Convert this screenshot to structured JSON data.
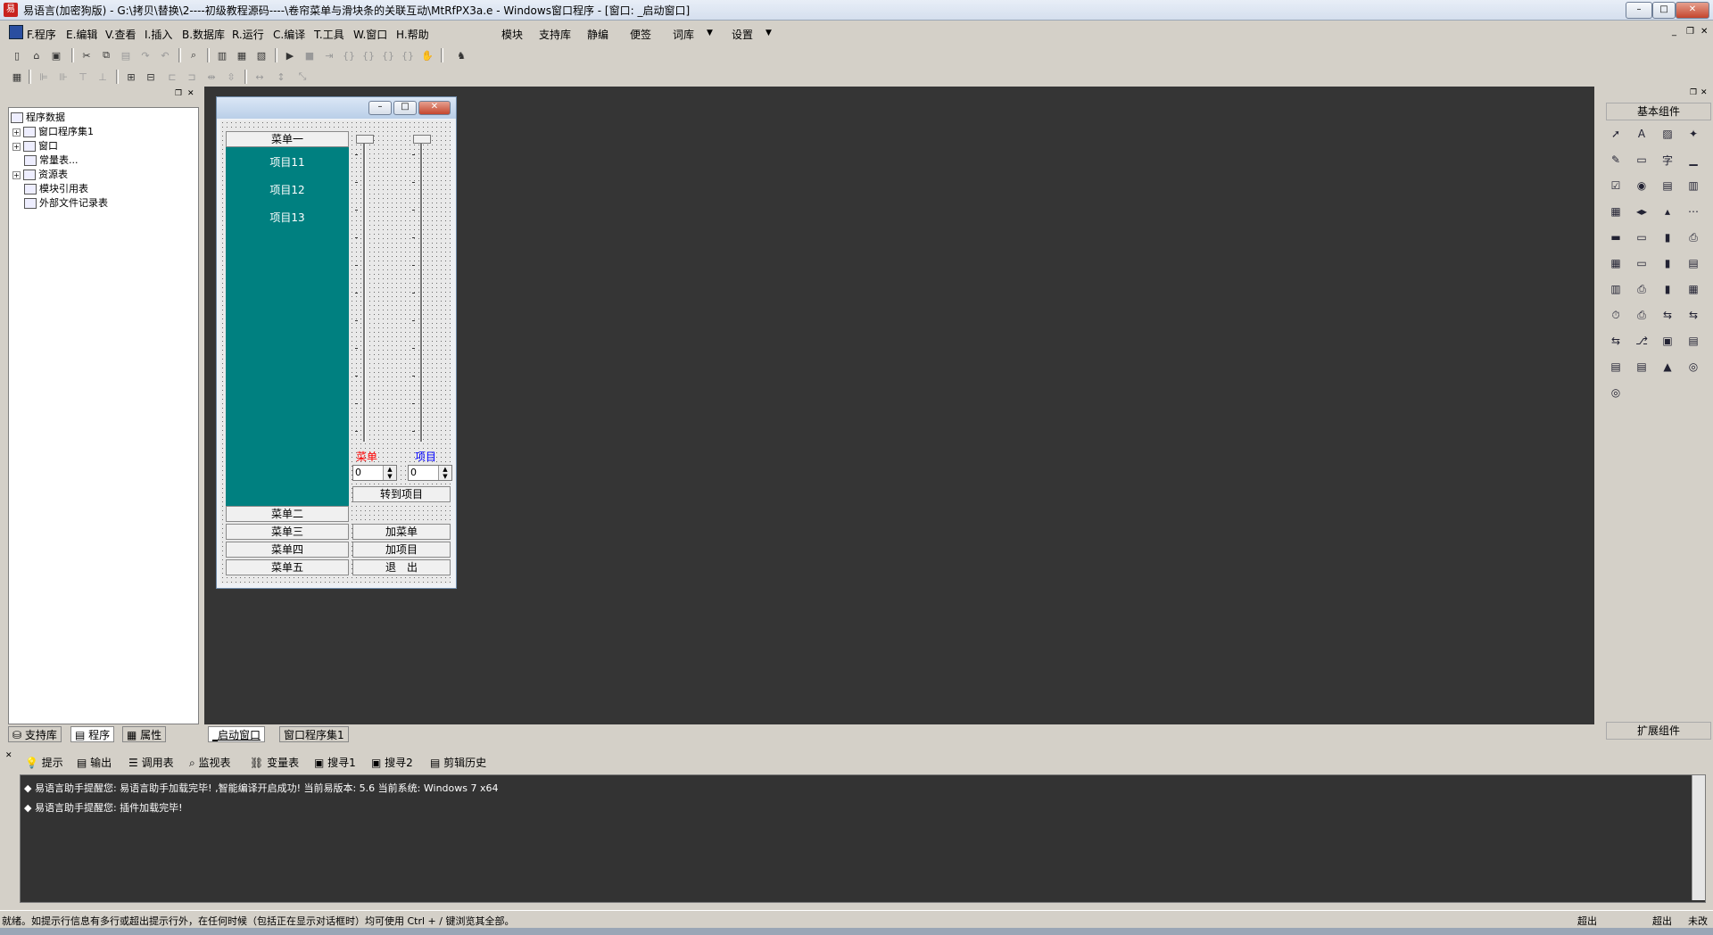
{
  "window": {
    "title": "易语言(加密狗版) - G:\\拷贝\\替换\\2----初级教程源码----\\卷帘菜单与滑块条的关联互动\\MtRfPX3a.e - Windows窗口程序 - [窗口: _启动窗口]",
    "minimize": "–",
    "maximize": "□",
    "close": "✕"
  },
  "menubar": {
    "items": [
      "F.程序",
      "E.编辑",
      "V.查看",
      "I.插入",
      "B.数据库",
      "R.运行",
      "C.编译",
      "T.工具",
      "W.窗口",
      "H.帮助"
    ],
    "extra": [
      "模块",
      "支持库",
      "静编",
      "便签",
      "词库",
      "设置"
    ]
  },
  "tree": {
    "root": "程序数据",
    "items": [
      "窗口程序集1",
      "窗口",
      "常量表...",
      "资源表",
      "模块引用表",
      "外部文件记录表"
    ]
  },
  "left_tabs": [
    "支持库",
    "程序",
    "属性"
  ],
  "form": {
    "menus": [
      "菜单一",
      "菜单二",
      "菜单三",
      "菜单四",
      "菜单五"
    ],
    "list_items": [
      "项目11",
      "项目12",
      "项目13"
    ],
    "slider_labels": [
      "菜单",
      "项目"
    ],
    "spin_values": [
      "0",
      "0"
    ],
    "buttons": [
      "转到项目",
      "加菜单",
      "加项目",
      "退　出"
    ]
  },
  "design_tabs": [
    "_启动窗口",
    "窗口程序集1"
  ],
  "right_panel": {
    "title": "基本组件",
    "footer": "扩展组件"
  },
  "output_tabs": [
    "提示",
    "输出",
    "调用表",
    "监视表",
    "变量表",
    "搜寻1",
    "搜寻2",
    "剪辑历史"
  ],
  "output_lines": [
    "易语言助手提醒您: 易语言助手加载完毕! ,智能编译开启成功! 当前易版本: 5.6 当前系统: Windows 7 x64",
    "易语言助手提醒您: 插件加载完毕!"
  ],
  "statusbar": {
    "text": "就绪。如提示行信息有多行或超出提示行外，在任何时候（包括正在显示对话框时）均可使用 Ctrl + / 键浏览其全部。",
    "right": [
      "超出",
      "超出",
      "未改"
    ]
  },
  "colors": {
    "list_bg": "#008080",
    "design_bg": "#353535",
    "label_menu": "#ff0000",
    "label_item": "#0000ff"
  }
}
